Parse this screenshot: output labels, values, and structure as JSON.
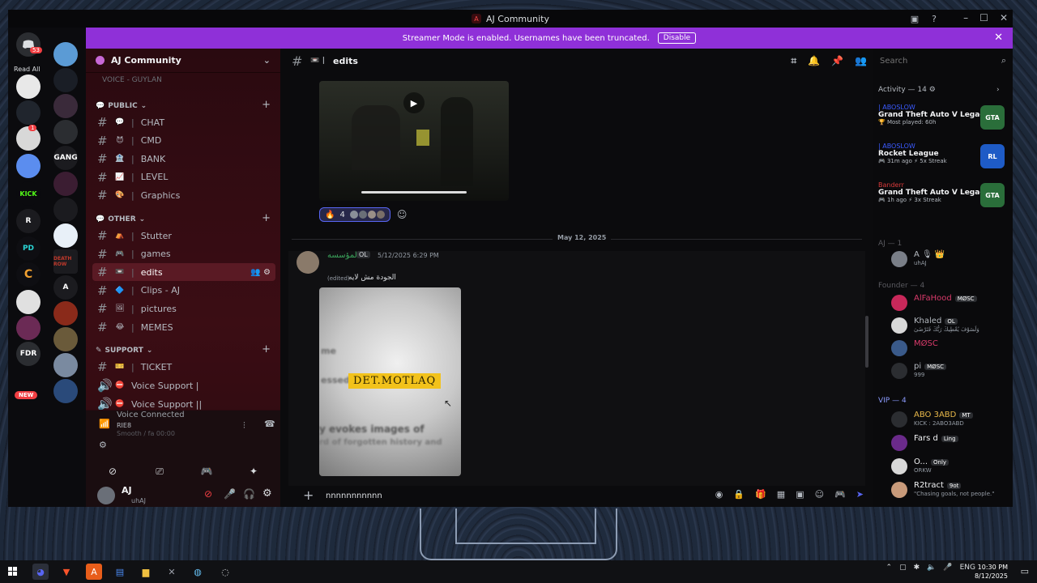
{
  "window": {
    "title": "AJ Community",
    "logo_glyph": "A",
    "controls": [
      "–",
      "☐",
      "✕"
    ],
    "inbox_glyph": "▣",
    "help_glyph": "?"
  },
  "banner": {
    "text": "Streamer Mode is enabled. Usernames have been truncated.",
    "button": "Disable",
    "close": "✕"
  },
  "guilds": {
    "read_all": "Read All",
    "dm_badge": "53",
    "badge_2": "1",
    "new_badge": "NEW",
    "items": [
      {
        "label": "",
        "color": "#5865f2"
      },
      {
        "label": "",
        "color": "#3a3f4a"
      },
      {
        "label": "",
        "color": "#e8e8e8"
      },
      {
        "label": "",
        "color": "#20252d"
      },
      {
        "label": "",
        "color": "#d8d8d8"
      },
      {
        "label": "",
        "color": "#5b8def"
      },
      {
        "label": "KICK",
        "color": "#0b0b0e"
      },
      {
        "label": "R",
        "color": "#1b1b1f"
      },
      {
        "label": "PD",
        "color": "#0e0e12"
      },
      {
        "label": "C",
        "color": "#0e0e12"
      },
      {
        "label": "",
        "color": "#e0e0e0"
      },
      {
        "label": "",
        "color": "#6b2a55"
      },
      {
        "label": "FDR",
        "color": "#2b2d31"
      }
    ],
    "col2": [
      {
        "label": "",
        "color": "#5b9bd5"
      },
      {
        "label": "",
        "color": "#1a1e26"
      },
      {
        "label": "",
        "color": "#3a2a3a"
      },
      {
        "label": "",
        "color": "#2b2d31"
      },
      {
        "label": "GANG",
        "color": "#1b1b1f"
      },
      {
        "label": "",
        "color": "#3b1d32"
      },
      {
        "label": "",
        "color": "#1b1b1f"
      },
      {
        "label": "",
        "color": "#e8f0f8"
      },
      {
        "label": "DEATH ROW",
        "color": "#1b1b1f"
      },
      {
        "label": "A",
        "color": "#1b1b1f"
      },
      {
        "label": "",
        "color": "#8a2a1a"
      },
      {
        "label": "",
        "color": "#6a5a3a"
      },
      {
        "label": "",
        "color": "#7a8aa0"
      },
      {
        "label": "",
        "color": "#2a4a7a"
      }
    ]
  },
  "sidebar": {
    "server_name": "AJ Community",
    "top_cut": "VOICE - GUYLAN",
    "categories": [
      {
        "name": "PUBLIC",
        "channels": [
          {
            "emoji": "💬",
            "name": "CHAT"
          },
          {
            "emoji": "😈",
            "name": "CMD"
          },
          {
            "emoji": "🏦",
            "name": "BANK"
          },
          {
            "emoji": "📈",
            "name": "LEVEL"
          },
          {
            "emoji": "🎨",
            "name": "Graphics"
          }
        ]
      },
      {
        "name": "OTHER",
        "channels": [
          {
            "emoji": "⛺",
            "name": "Stutter"
          },
          {
            "emoji": "🎮",
            "name": "games"
          },
          {
            "emoji": "📼",
            "name": "edits"
          },
          {
            "emoji": "🔷",
            "name": "Clips - AJ"
          },
          {
            "emoji": "🖼",
            "name": "pictures"
          },
          {
            "emoji": "😂",
            "name": "MEMES"
          }
        ]
      },
      {
        "name": "SUPPORT",
        "channels": [
          {
            "emoji": "🎫",
            "name": "TICKET"
          }
        ]
      }
    ],
    "voice_channels": [
      {
        "name": "Voice Support |"
      },
      {
        "name": "Voice Support ||"
      }
    ],
    "voice": {
      "title": "Voice Connected",
      "sub": "RIE8",
      "sub2": "Smooth / fa 00:00"
    },
    "user": {
      "name": "AJ",
      "status": "uhAJ"
    }
  },
  "channel": {
    "name": "edits",
    "date_divider": "May 12, 2025",
    "reactions": [
      {
        "emoji": "🔥",
        "count": "4"
      }
    ],
    "message": {
      "author": "المؤسسه",
      "badge": "OL",
      "time": "5/12/2025 6:29 PM",
      "edited": "(edited)",
      "content": "الجودة مش لايه"
    },
    "image": {
      "tag": "DET.MOTLAQ",
      "ghost1": "me",
      "ghost2": "essed",
      "ghost3": "y evokes images of",
      "ghost4": "rd of forgotten history and"
    },
    "composer_value": "nnnnnnnnnnn"
  },
  "members": {
    "search_placeholder": "Search",
    "activity_title": "Activity — 14",
    "activities": [
      {
        "who": "| ABOSLOW",
        "game": "Grand Theft Auto V Legacy",
        "meta": "🏆 Most played: 60h",
        "icon": "GTA",
        "color": "#2a6e3a"
      },
      {
        "who": "| ABOSLOW",
        "game": "Rocket League",
        "meta": "🎮 31m ago  ⚡ 5x Streak",
        "icon": "RL",
        "color": "#1e5bc6"
      },
      {
        "who": "Banderr",
        "game": "Grand Theft Auto V Legacy",
        "meta": "🎮 1h ago  ⚡ 3x Streak",
        "icon": "GTA",
        "color": "#2a6e3a"
      }
    ],
    "sec1": "AJ — 1",
    "aj_member": {
      "name": "A",
      "status": "uhAJ"
    },
    "sec2": "Founder — 4",
    "founders": [
      {
        "name": "AlFaHood",
        "badge": "MØSC",
        "status": ""
      },
      {
        "name": "Khaled",
        "badge": "OL",
        "status": "وَلَسَوْفَ يُعْطِيكَ رَبُّكَ فَتَرْضَىٰ"
      },
      {
        "name": "MØSC",
        "badge": "",
        "status": ""
      },
      {
        "name": "pi",
        "badge": "MØSC",
        "status": "999"
      }
    ],
    "vip_title": "VIP — 4",
    "vips": [
      {
        "name": "ABO 3ABD",
        "badge": "MT",
        "status": "KICK : 2ABO3ABD"
      },
      {
        "name": "Fars d",
        "badge": "Ling",
        "status": ""
      },
      {
        "name": "O...",
        "badge": "Only",
        "status": "ORKW"
      },
      {
        "name": "R2tract",
        "badge": "9ot",
        "status": "\"Chasing goals, not people.\""
      }
    ]
  },
  "taskbar": {
    "lang": "ENG",
    "time": "10:30 PM",
    "date": "8/12/2025"
  }
}
